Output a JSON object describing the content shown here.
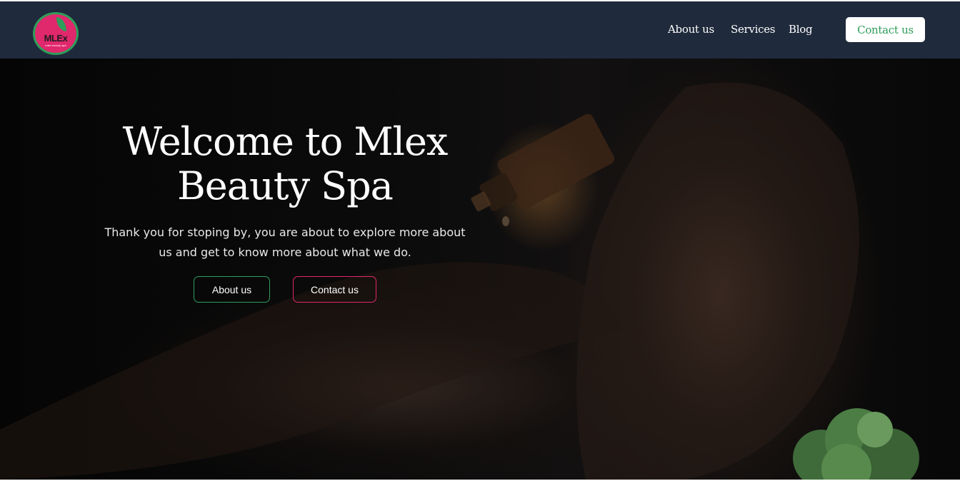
{
  "brand": {
    "logo_text": "MLEx",
    "logo_subtext": "mlex beauty spa",
    "colors": {
      "primary_pink": "#e0286c",
      "primary_green": "#2e9e5a",
      "nav_bg": "#1f2a3c"
    }
  },
  "nav": {
    "links": [
      {
        "label": "About us"
      },
      {
        "label": "Services"
      },
      {
        "label": "Blog"
      }
    ],
    "cta_label": "Contact us"
  },
  "hero": {
    "title_line1": "Welcome to Mlex",
    "title_line2": "Beauty Spa",
    "subtitle": "Thank you for stoping by, you are about to explore more about us and get to know more about what we do.",
    "buttons": {
      "about_label": "About us",
      "contact_label": "Contact us"
    }
  }
}
